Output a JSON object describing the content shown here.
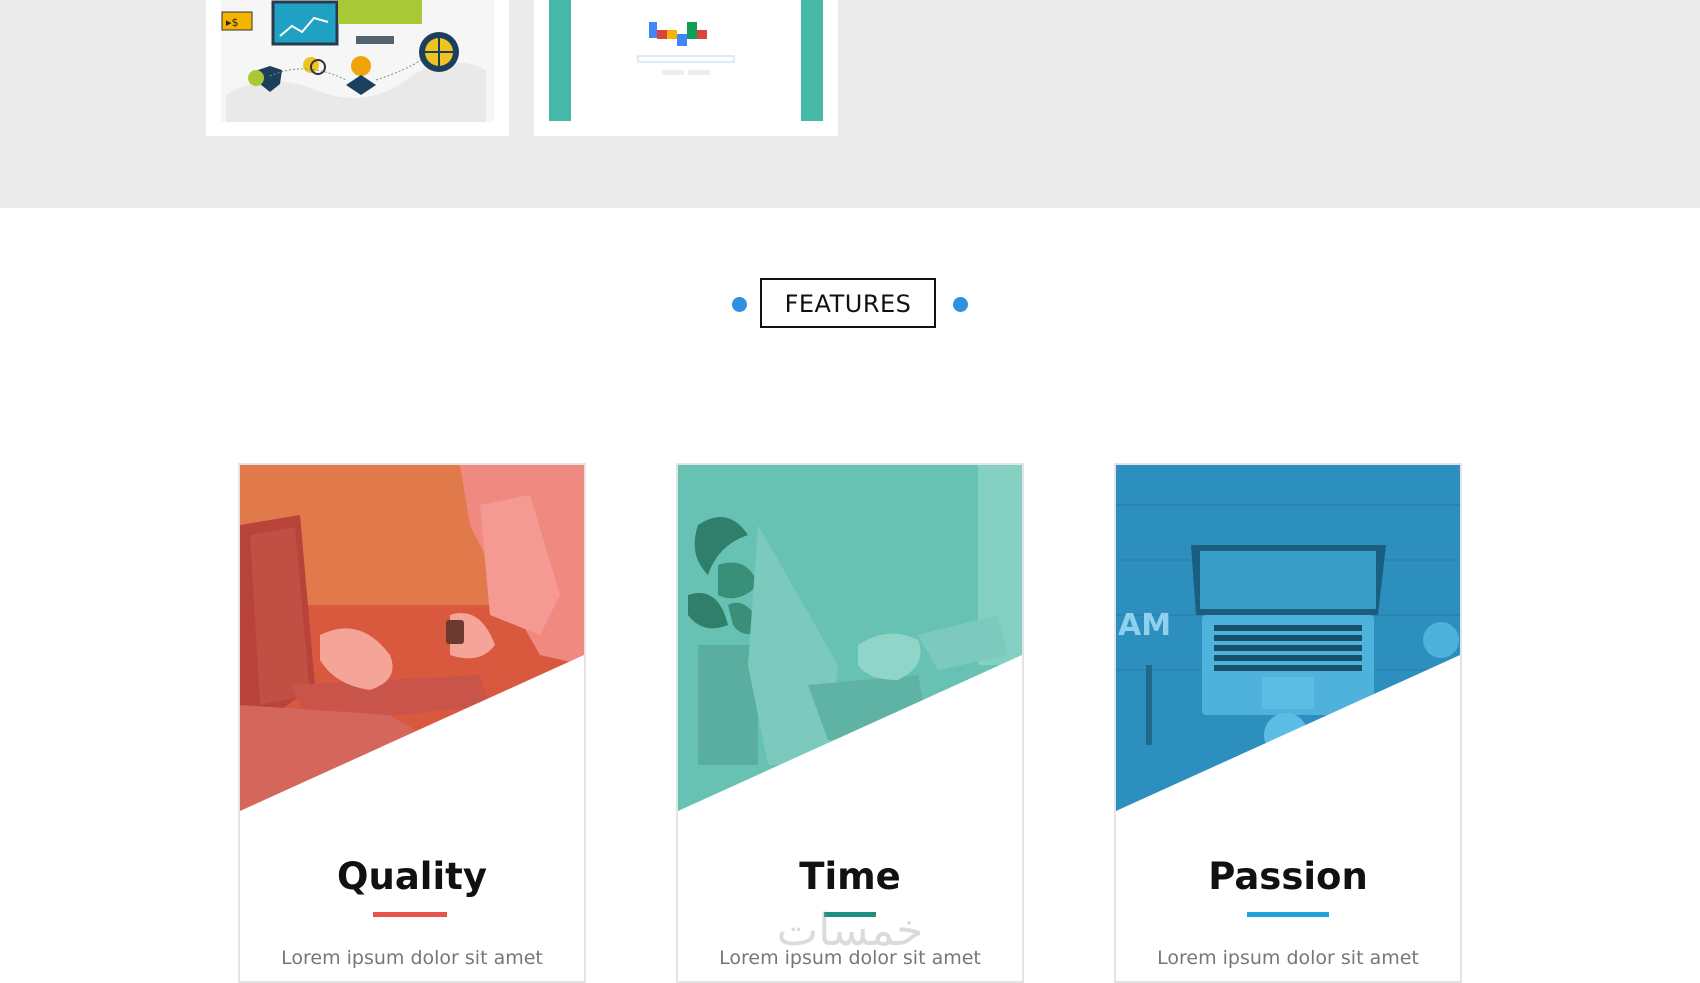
{
  "features": {
    "heading": "FEATURES",
    "accent": "#2f8fe0"
  },
  "cards": [
    {
      "title": "Quality",
      "text": "Lorem ipsum dolor sit amet",
      "underline_color": "#e8524a",
      "overlay_color": "#e55f50",
      "photo": "laptop-woman-photo"
    },
    {
      "title": "Time",
      "text": "Lorem ipsum dolor sit amet",
      "underline_color": "#1f8f80",
      "overlay_color": "#4fbaa8",
      "photo": "typing-plant-photo"
    },
    {
      "title": "Passion",
      "text": "Lorem ipsum dolor sit amet",
      "underline_color": "#1fa1dc",
      "overlay_color": "#2a9bc9",
      "photo": "laptop-desk-photo"
    }
  ],
  "watermark": "خمسات"
}
